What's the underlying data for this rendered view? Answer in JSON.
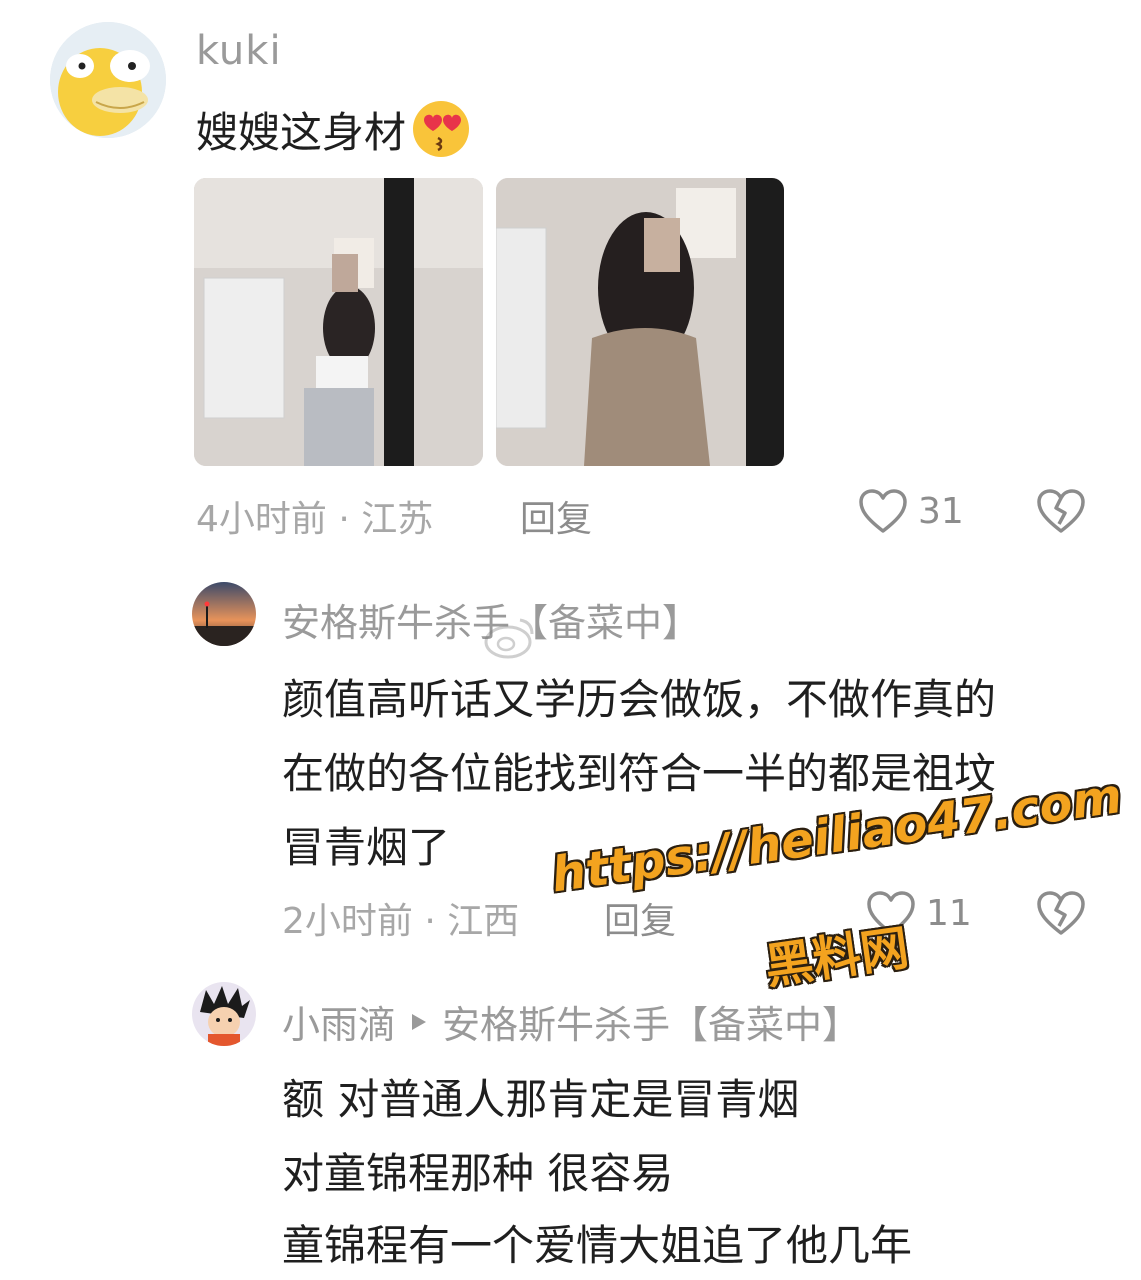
{
  "comment_main": {
    "avatar_icon": "psyduck-avatar-icon",
    "username": "kuki",
    "text": "嫂嫂这身材",
    "emoji": "heart-eyes-kiss-emoji",
    "photos": [
      "photo-white-top-mirror-selfie",
      "photo-beige-dress-mirror-selfie"
    ],
    "meta": "4小时前 · 江苏",
    "reply_label": "回复",
    "like_count": "31"
  },
  "reply_1": {
    "avatar_icon": "sunset-street-avatar-icon",
    "username": "安格斯牛杀手【备菜中】",
    "lines": [
      "颜值高听话又学历会做饭，不做作真的",
      "在做的各位能找到符合一半的都是祖坟",
      "冒青烟了"
    ],
    "meta": "2小时前 · 江西",
    "reply_label": "回复",
    "like_count": "11"
  },
  "reply_2": {
    "avatar_icon": "cartoon-boy-avatar-icon",
    "username": "小雨滴",
    "reply_to": "安格斯牛杀手【备菜中】",
    "lines": [
      "额 对普通人那肯定是冒青烟",
      "对童锦程那种 很容易",
      "童锦程有一个爱情大姐追了他几年"
    ]
  },
  "watermark": {
    "url": "https://heiliao47.com",
    "label": "黑料网"
  },
  "colors": {
    "username": "#9a9a9a",
    "text": "#1f1f1f",
    "meta": "#a7a7a7",
    "watermark": "#f3a31f"
  }
}
